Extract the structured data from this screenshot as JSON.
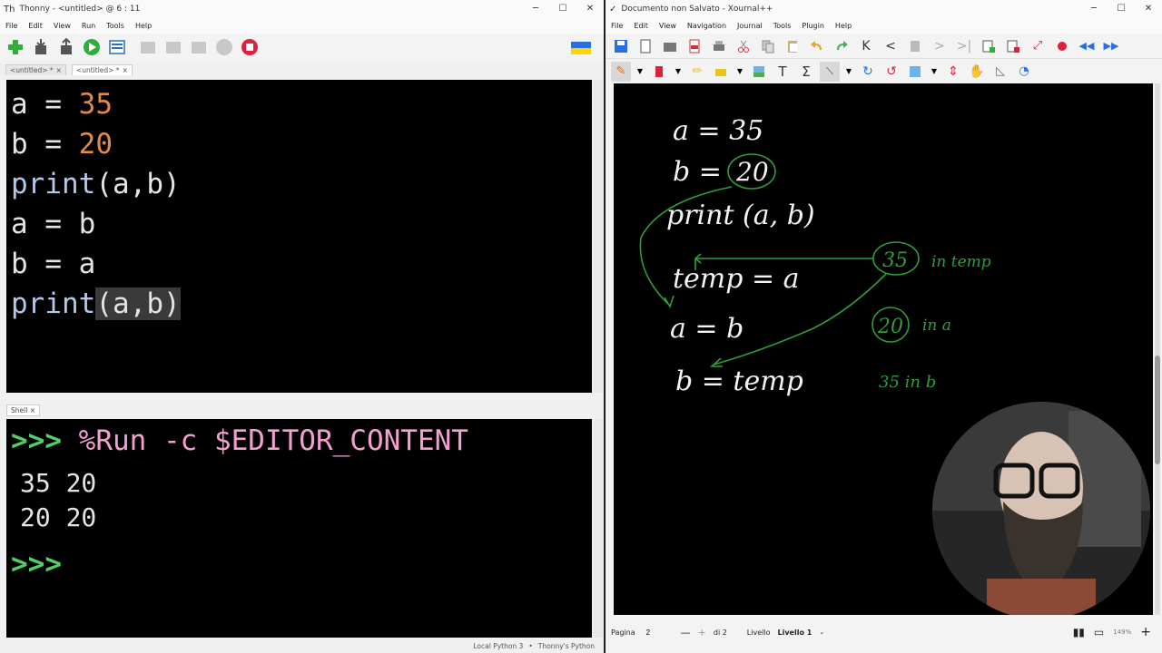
{
  "thonny": {
    "title": "Thonny - <untitled> @ 6 : 11",
    "menu": [
      "File",
      "Edit",
      "View",
      "Run",
      "Tools",
      "Help"
    ],
    "tabs": [
      "<untitled> *",
      "<untitled> *"
    ],
    "editor_lines": [
      {
        "a": "a",
        "b": " = ",
        "c": "35"
      },
      {
        "a": "b",
        "b": " = ",
        "c": "20"
      },
      {
        "a": "print",
        "b": "(a,b)",
        "c": ""
      },
      {
        "a": "a",
        "b": " = b",
        "c": ""
      },
      {
        "a": "b",
        "b": " = a",
        "c": ""
      },
      {
        "a": "print",
        "b": "(a,b)",
        "c": ""
      }
    ],
    "shell_tab": "Shell",
    "shell": {
      "prompt": ">>>",
      "command": "%Run -c $EDITOR_CONTENT",
      "out1": "35 20",
      "out2": "20 20"
    },
    "status": {
      "interpreter": "Local Python 3",
      "sep": "•",
      "python": "Thonny's Python"
    }
  },
  "xournal": {
    "title": "Documento non Salvato - Xournal++",
    "menu": [
      "File",
      "Edit",
      "View",
      "Navigation",
      "Journal",
      "Tools",
      "Plugin",
      "Help"
    ],
    "status": {
      "page_label": "Pagina",
      "page_value": "2",
      "of_label": "di 2",
      "layer_label": "Livello",
      "layer_value": "Livello 1",
      "zoom": "149%"
    },
    "notes": {
      "a35": "a = 35",
      "b20_lhs": "b =",
      "b20_val": "20",
      "print": "print (a, b)",
      "temp": "temp = a",
      "a_b": "a = b",
      "b_temp": "b = temp",
      "v35": "35",
      "in_temp": "in temp",
      "v20": "20",
      "in_a": "in a",
      "in_b": "35  in  b"
    }
  },
  "colors": {
    "green_ink": "#2f9e3a",
    "accent_red": "#e0203a"
  }
}
